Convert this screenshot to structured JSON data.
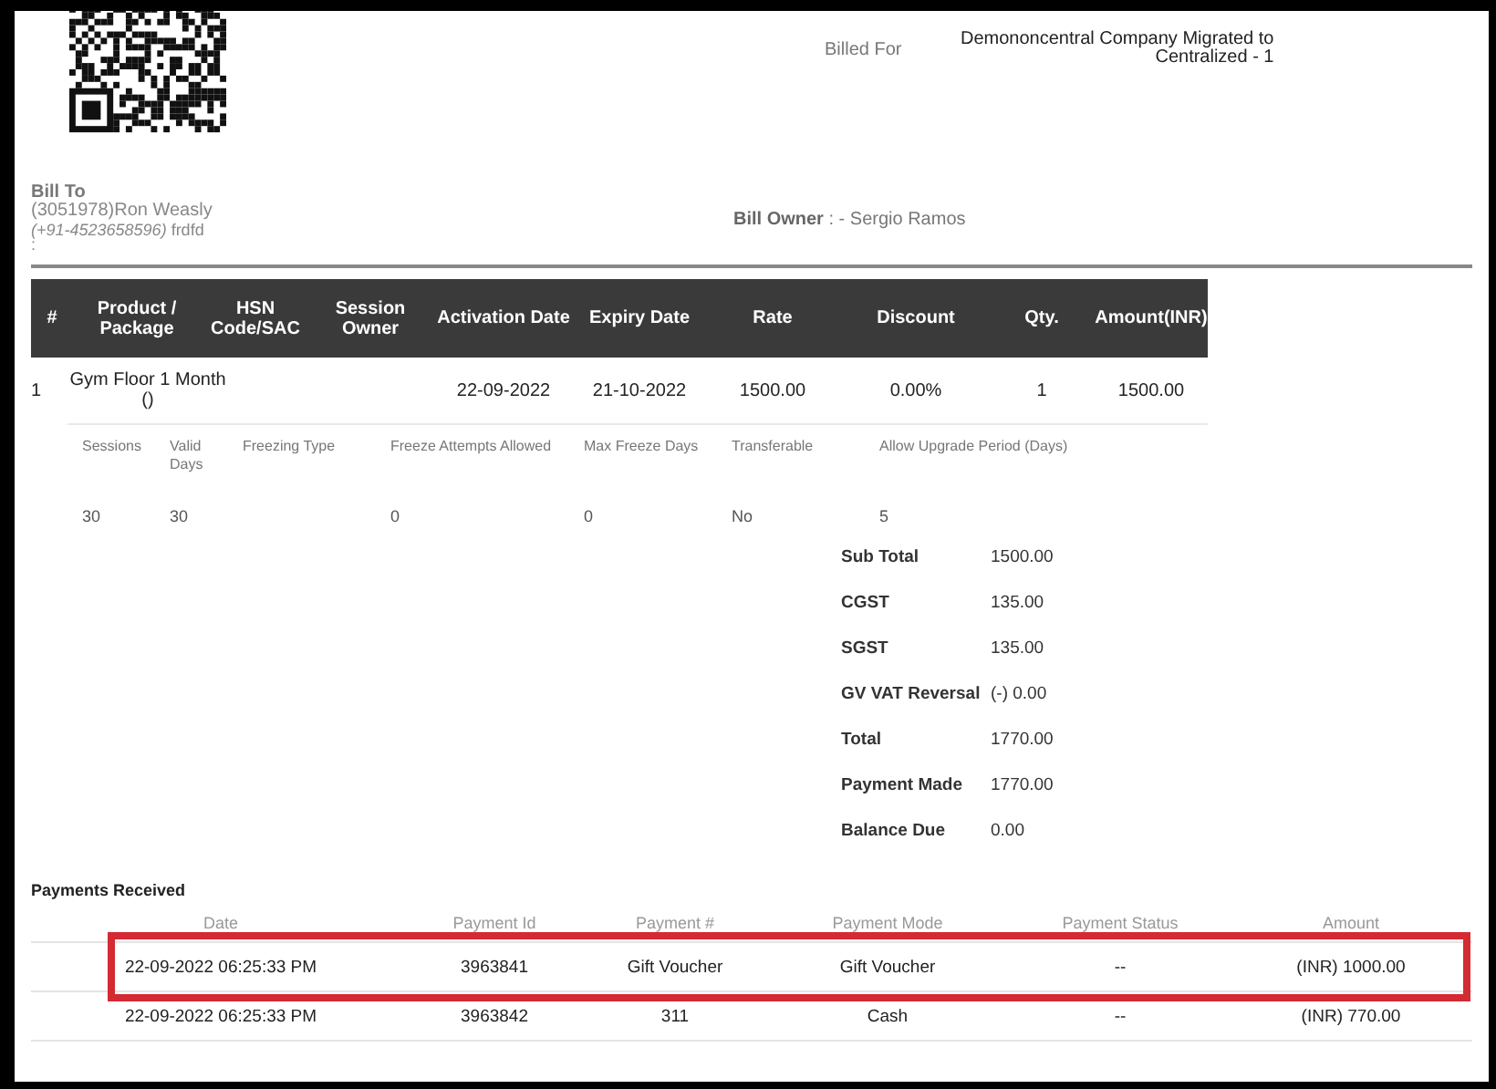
{
  "header": {
    "billed_for_label": "Billed For",
    "billed_for_value": "Demononcentral Company Migrated to Centralized - 1"
  },
  "bill_to": {
    "label": "Bill To",
    "customer": "(3051978)Ron Weasly",
    "phone": "(+91-4523658596)",
    "phone_note": "frdfd",
    "extra": ":"
  },
  "bill_owner": {
    "label": "Bill Owner",
    "value": ": - Sergio Ramos"
  },
  "items_table": {
    "columns": [
      "#",
      "Product / Package",
      "HSN Code/SAC",
      "Session Owner",
      "Activation Date",
      "Expiry Date",
      "Rate",
      "Discount",
      "Qty.",
      "Amount(INR)"
    ],
    "rows": [
      {
        "cells": [
          "1",
          "Gym Floor 1 Month ()",
          null,
          null,
          "22-09-2022",
          "21-10-2022",
          "1500.00",
          "0.00%",
          "1",
          "1500.00"
        ]
      }
    ]
  },
  "details": [
    {
      "label": "Sessions",
      "value": "30"
    },
    {
      "label": "Valid Days",
      "value": "30"
    },
    {
      "label": "Freezing Type"
    },
    {
      "label": "Freeze Attempts Allowed",
      "value": "0"
    },
    {
      "label": "Max Freeze Days",
      "value": "0"
    },
    {
      "label": "Transferable",
      "value": "No"
    },
    {
      "label": "Allow Upgrade Period (Days)",
      "value": "5"
    }
  ],
  "totals": [
    {
      "label": "Sub Total",
      "value": "1500.00"
    },
    {
      "label": "CGST",
      "value": "135.00"
    },
    {
      "label": "SGST",
      "value": "135.00"
    },
    {
      "label": "GV VAT Reversal",
      "value": "(-) 0.00"
    },
    {
      "label": "Total",
      "value": "1770.00"
    },
    {
      "label": "Payment Made",
      "value": "1770.00"
    },
    {
      "label": "Balance Due",
      "value": "0.00"
    }
  ],
  "payments": {
    "title": "Payments Received",
    "columns": [
      "Date",
      "Payment Id",
      "Payment #",
      "Payment Mode",
      "Payment Status",
      "Amount"
    ],
    "rows": [
      {
        "highlighted": true,
        "cells": [
          "22-09-2022 06:25:33 PM",
          "3963841",
          "Gift Voucher",
          "Gift Voucher",
          "--",
          "(INR) 1000.00"
        ]
      },
      {
        "highlighted": false,
        "cells": [
          "22-09-2022 06:25:33 PM",
          "3963842",
          "311",
          "Cash",
          "--",
          "(INR) 770.00"
        ]
      }
    ]
  }
}
